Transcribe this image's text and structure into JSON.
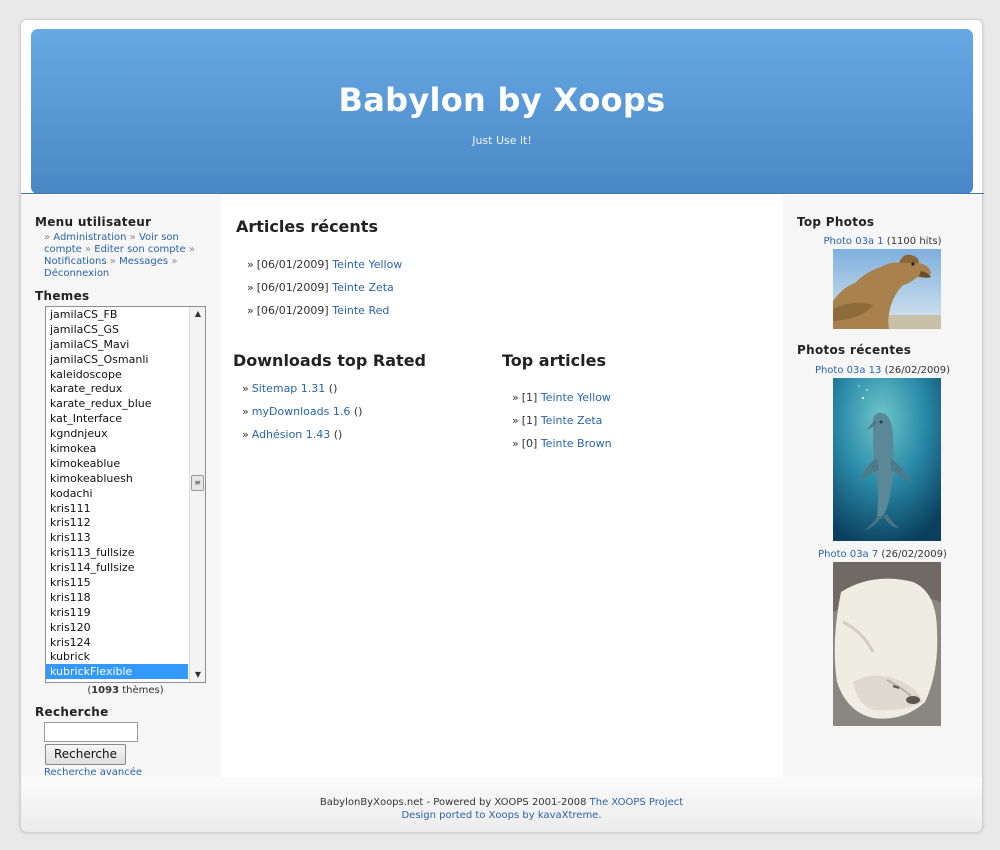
{
  "site": {
    "title": "Babylon by Xoops",
    "slogan": "Just Use it!"
  },
  "usermenu": {
    "title": "Menu utilisateur",
    "items": [
      "Administration",
      "Voir son compte",
      "Editer son compte",
      "Notifications",
      "Messages",
      "Déconnexion"
    ]
  },
  "themes": {
    "title": "Themes",
    "options": [
      "jamilaCS_FB",
      "jamilaCS_GS",
      "jamilaCS_Mavi",
      "jamilaCS_Osmanli",
      "kaleidoscope",
      "karate_redux",
      "karate_redux_blue",
      "kat_Interface",
      "kgndnjeux",
      "kimokea",
      "kimokeablue",
      "kimokeabluesh",
      "kodachi",
      "kris111",
      "kris112",
      "kris113",
      "kris113_fullsize",
      "kris114_fullsize",
      "kris115",
      "kris118",
      "kris119",
      "kris120",
      "kris124",
      "kubrick",
      "kubrickFlexible"
    ],
    "selected": "kubrickFlexible",
    "count": "1093",
    "count_suffix": "thèmes"
  },
  "search": {
    "title": "Recherche",
    "button": "Recherche",
    "advanced": "Recherche avancée",
    "value": ""
  },
  "recent_articles": {
    "title": "Articles récents",
    "items": [
      {
        "date": "[06/01/2009]",
        "label": "Teinte Yellow"
      },
      {
        "date": "[06/01/2009]",
        "label": "Teinte Zeta"
      },
      {
        "date": "[06/01/2009]",
        "label": "Teinte Red"
      }
    ]
  },
  "downloads": {
    "title": "Downloads top Rated",
    "items": [
      {
        "label": "Sitemap 1.31",
        "suffix": "()"
      },
      {
        "label": "myDownloads 1.6",
        "suffix": "()"
      },
      {
        "label": "Adhésion 1.43",
        "suffix": "()"
      }
    ]
  },
  "top_articles": {
    "title": "Top articles",
    "items": [
      {
        "count": "[1]",
        "label": "Teinte Yellow"
      },
      {
        "count": "[1]",
        "label": "Teinte Zeta"
      },
      {
        "count": "[0]",
        "label": "Teinte Brown"
      }
    ]
  },
  "top_photos": {
    "title": "Top Photos",
    "items": [
      {
        "label": "Photo 03a 1",
        "info": "(1100 hits)",
        "subject": "camel-photo"
      }
    ]
  },
  "recent_photos": {
    "title": "Photos récentes",
    "items": [
      {
        "label": "Photo 03a 13",
        "info": "(26/02/2009)",
        "subject": "dolphin-photo"
      },
      {
        "label": "Photo 03a 7",
        "info": "(26/02/2009)",
        "subject": "polar-bear-photo"
      }
    ]
  },
  "footer": {
    "line1_text": "BabylonByXoops.net - Powered by XOOPS 2001-2008",
    "line1_link": "The XOOPS Project",
    "line2": "Design ported to Xoops by kavaXtreme."
  },
  "colors": {
    "link": "#2a64a8",
    "header_top": "#67a9e4",
    "header_bottom": "#4a87c6",
    "selected": "#3399ff"
  }
}
